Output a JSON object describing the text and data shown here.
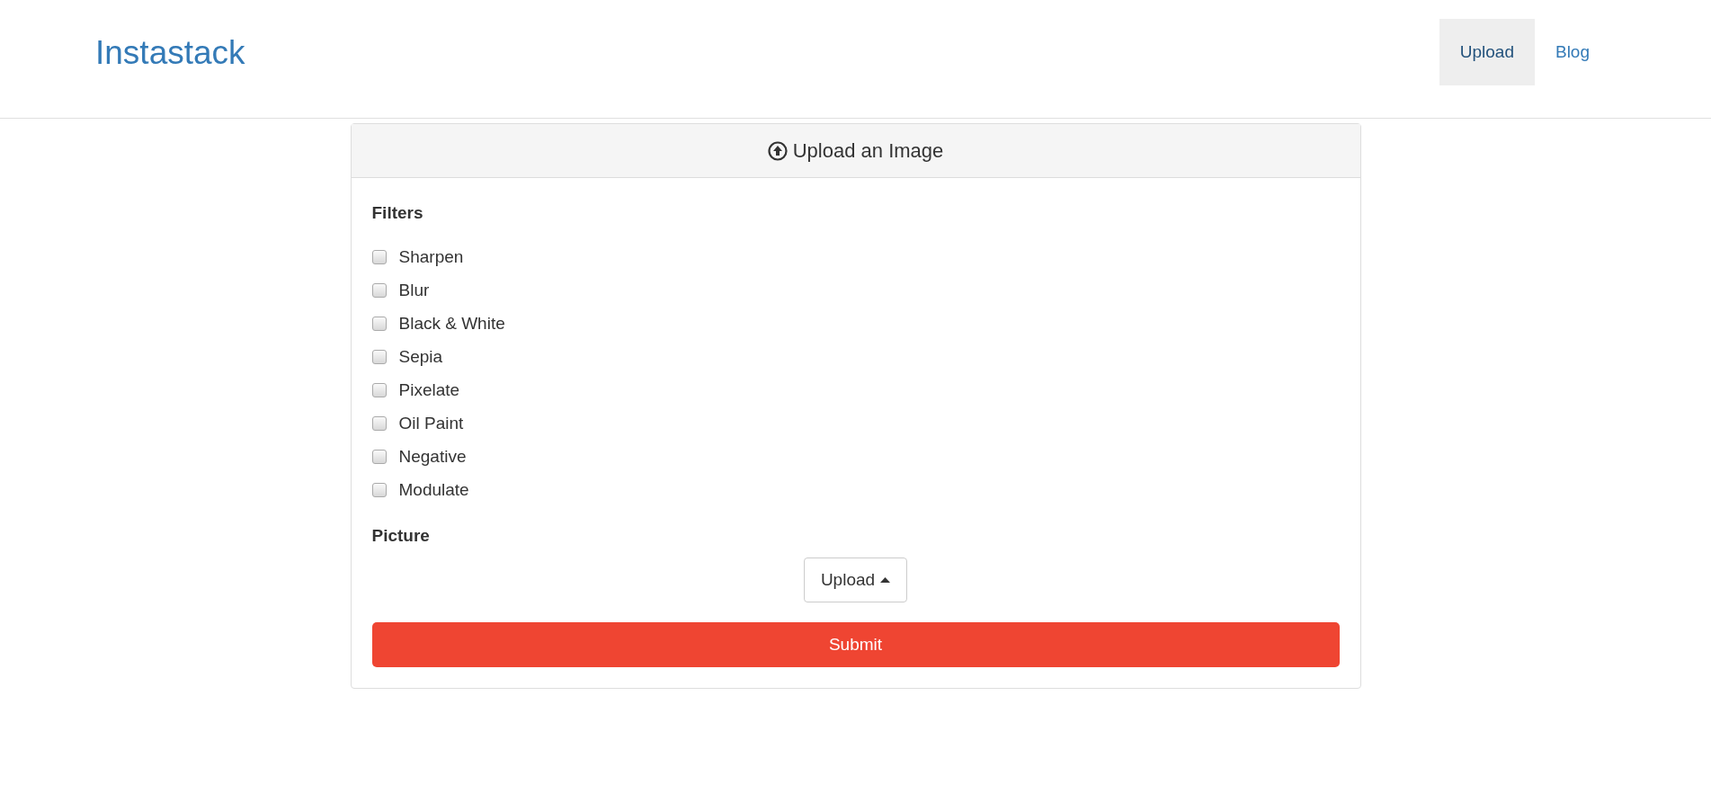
{
  "navbar": {
    "brand": "Instastack",
    "links": [
      {
        "label": "Upload",
        "selected": true
      },
      {
        "label": "Blog",
        "selected": false
      }
    ]
  },
  "panel": {
    "title": "Upload an Image",
    "filters_label": "Filters",
    "filters": [
      {
        "label": "Sharpen",
        "checked": false
      },
      {
        "label": "Blur",
        "checked": false
      },
      {
        "label": "Black & White",
        "checked": false
      },
      {
        "label": "Sepia",
        "checked": false
      },
      {
        "label": "Pixelate",
        "checked": false
      },
      {
        "label": "Oil Paint",
        "checked": false
      },
      {
        "label": "Negative",
        "checked": false
      },
      {
        "label": "Modulate",
        "checked": false
      }
    ],
    "picture_label": "Picture",
    "upload_button": "Upload",
    "submit_button": "Submit"
  }
}
